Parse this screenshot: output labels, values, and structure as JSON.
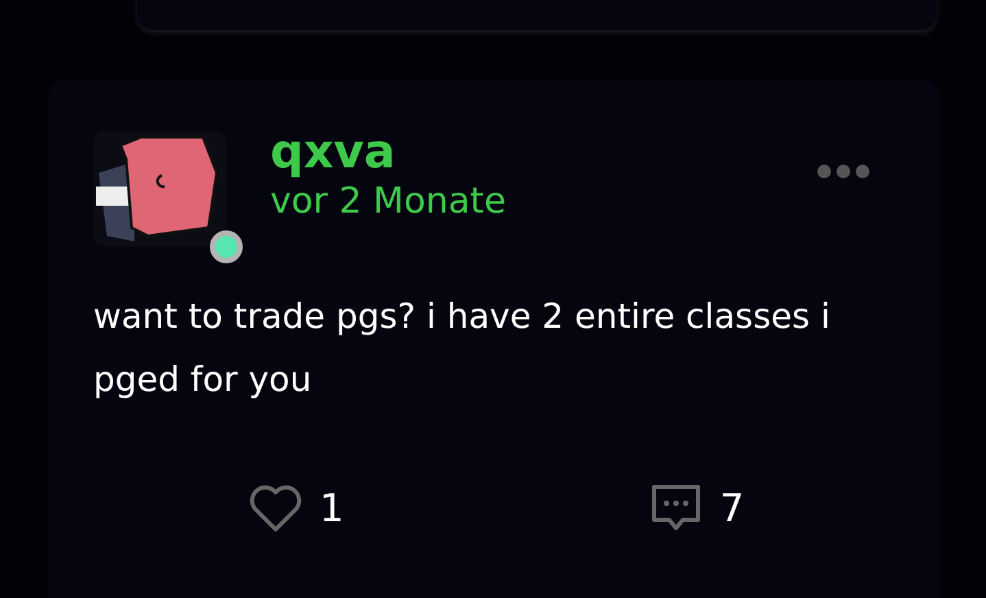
{
  "post": {
    "author": "qxva",
    "time": "vor 2 Monate",
    "online": true,
    "text": "want to trade pgs? i have 2 entire classes i pged for you",
    "liked": false,
    "likes": "1",
    "comments": "7"
  }
}
